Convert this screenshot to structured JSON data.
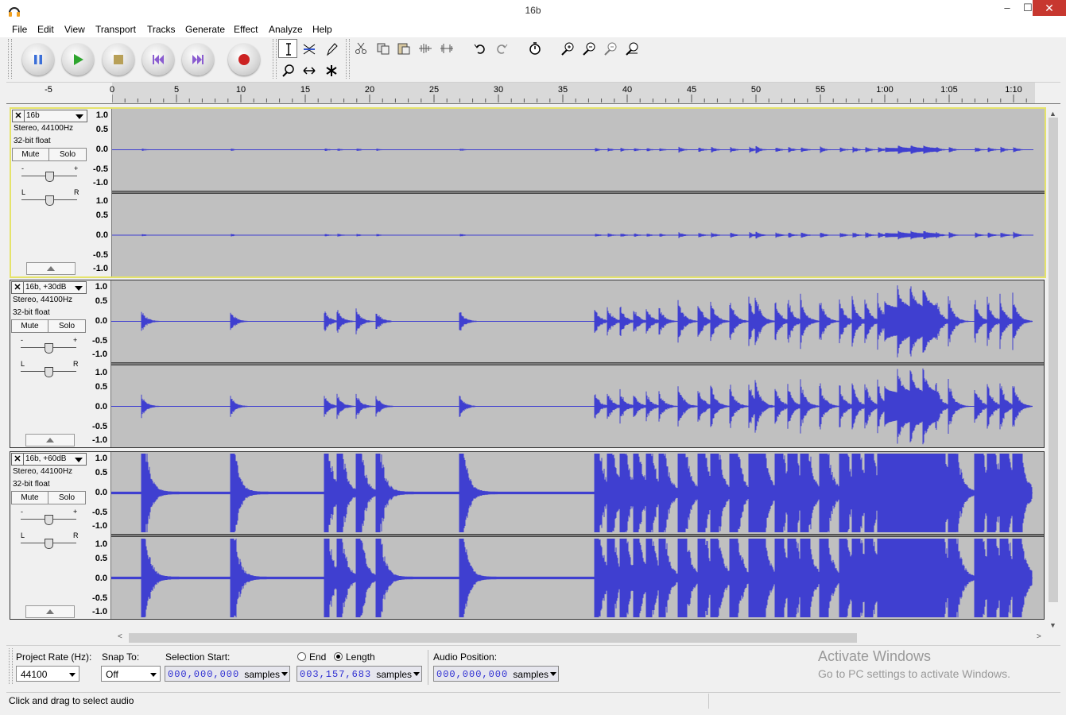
{
  "window": {
    "title": "16b",
    "minimize": "–",
    "maximize": "☐",
    "close": "✕"
  },
  "menu": [
    "File",
    "Edit",
    "View",
    "Transport",
    "Tracks",
    "Generate",
    "Effect",
    "Analyze",
    "Help"
  ],
  "transport": {
    "buttons": [
      {
        "name": "pause-button",
        "icon": "pause-icon",
        "color": "#3b6fd8"
      },
      {
        "name": "play-button",
        "icon": "play-icon",
        "color": "#2ea52e"
      },
      {
        "name": "stop-button",
        "icon": "stop-icon",
        "color": "#b8a058"
      },
      {
        "name": "skip-start-button",
        "icon": "skip-start-icon",
        "color": "#8a5cd0"
      },
      {
        "name": "skip-end-button",
        "icon": "skip-end-icon",
        "color": "#8a5cd0"
      },
      {
        "name": "record-button",
        "icon": "record-icon",
        "color": "#cc2222"
      }
    ]
  },
  "tools": [
    "selection-tool",
    "envelope-tool",
    "draw-tool",
    "zoom-tool",
    "timeshift-tool",
    "multi-tool"
  ],
  "edit_tools": [
    "cut-icon",
    "copy-icon",
    "paste-icon",
    "trim-icon",
    "silence-icon",
    "undo-icon",
    "redo-icon",
    "sync-lock-icon",
    "zoom-in-icon",
    "zoom-out-icon",
    "fit-selection-icon",
    "fit-project-icon"
  ],
  "ruler": {
    "labels": [
      "-5",
      "0",
      "5",
      "10",
      "15",
      "20",
      "25",
      "30",
      "35",
      "40",
      "45",
      "50",
      "55",
      "1:00",
      "1:05",
      "1:10"
    ]
  },
  "tracks": [
    {
      "name": "16b",
      "format": "Stereo, 44100Hz",
      "bits": "32-bit float",
      "mute": "Mute",
      "solo": "Solo",
      "close": "✕",
      "selected": true,
      "scale": [
        "1.0",
        "0.5",
        "0.0",
        "-0.5",
        "-1.0"
      ]
    },
    {
      "name": "16b, +30dB",
      "format": "Stereo, 44100Hz",
      "bits": "32-bit float",
      "mute": "Mute",
      "solo": "Solo",
      "close": "✕",
      "selected": false,
      "scale": [
        "1.0",
        "0.5",
        "0.0",
        "-0.5",
        "-1.0"
      ]
    },
    {
      "name": "16b, +60dB",
      "format": "Stereo, 44100Hz",
      "bits": "32-bit float",
      "mute": "Mute",
      "solo": "Solo",
      "close": "✕",
      "selected": false,
      "scale": [
        "1.0",
        "0.5",
        "0.0",
        "-0.5",
        "-1.0"
      ]
    }
  ],
  "slider_labels": {
    "minus": "-",
    "plus": "+",
    "left": "L",
    "right": "R"
  },
  "wave_color": "#3f3fd0",
  "selection_bar": {
    "project_rate_label": "Project Rate (Hz):",
    "project_rate": "44100",
    "snap_to_label": "Snap To:",
    "snap_to": "Off",
    "selection_start_label": "Selection Start:",
    "selection_start": "000,000,000",
    "end_label": "End",
    "length_label": "Length",
    "length": "003,157,683",
    "audio_position_label": "Audio Position:",
    "audio_position": "000,000,000",
    "units": "samples"
  },
  "watermark": {
    "title": "Activate Windows",
    "subtitle": "Go to PC settings to activate Windows."
  },
  "status": "Click and drag to select audio"
}
